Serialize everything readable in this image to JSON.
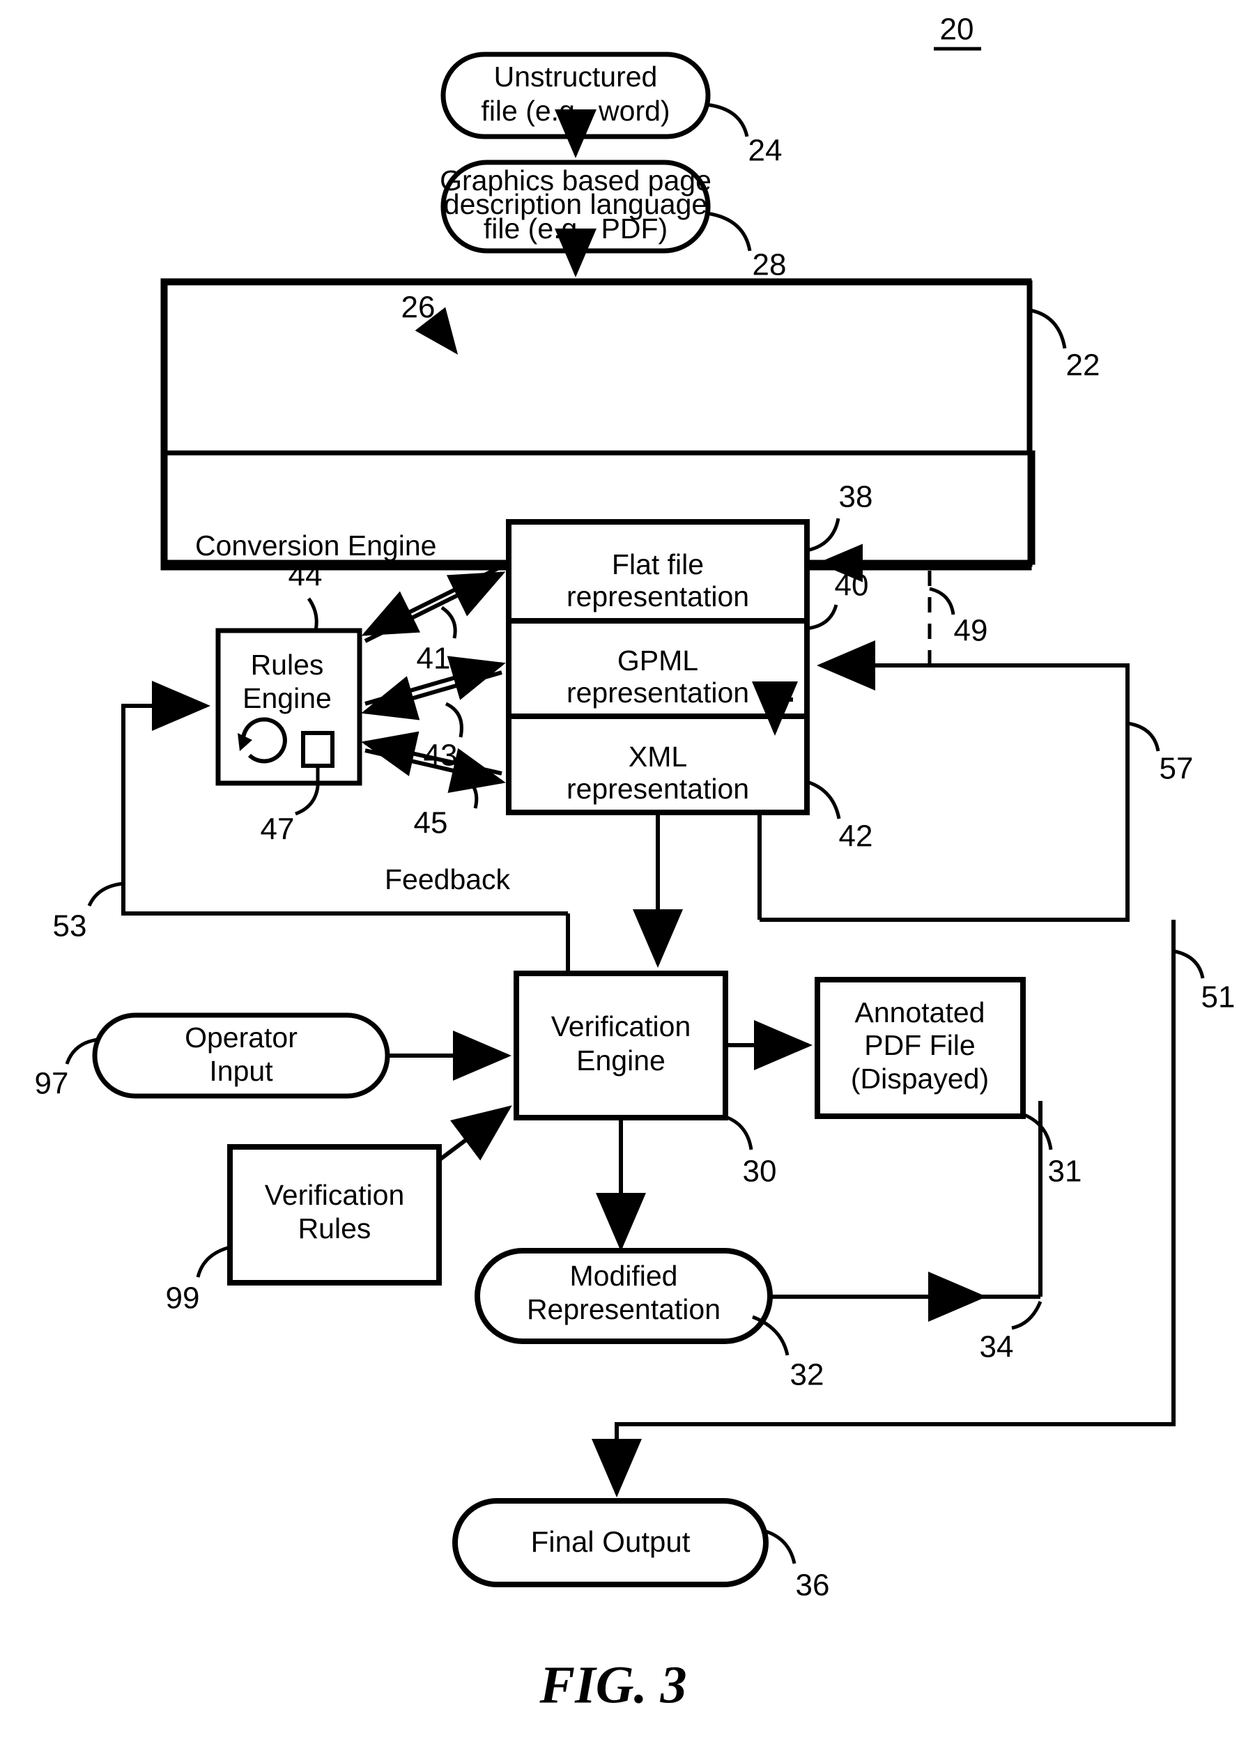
{
  "figure": {
    "caption": "FIG. 3",
    "system_ref": "20"
  },
  "nodes": {
    "unstructured_file": {
      "line1": "Unstructured",
      "line2": "file (e.g., word)",
      "ref": "24",
      "shape": "stadium"
    },
    "pdl_file": {
      "line1": "Graphics based page",
      "line2": "description language",
      "line3": "file (e.g., PDF)",
      "ref": "28",
      "shape": "stadium"
    },
    "system_box": {
      "ref": "22",
      "shape": "rect"
    },
    "conversion_engine": {
      "label": "Conversion Engine",
      "ref": "26",
      "shape": "rect"
    },
    "rules_engine": {
      "line1": "Rules",
      "line2": "Engine",
      "ref": "44",
      "inner_ref": "47",
      "shape": "rect"
    },
    "flat_file_representation": {
      "line1": "Flat file",
      "line2": "representation",
      "ref": "38",
      "shape": "rect"
    },
    "gpml_representation": {
      "line1": "GPML",
      "line2": "representation",
      "ref": "40",
      "shape": "rect"
    },
    "xml_representation": {
      "line1": "XML",
      "line2": "representation",
      "ref": "42",
      "shape": "rect"
    },
    "verification_engine": {
      "line1": "Verification",
      "line2": "Engine",
      "ref": "30",
      "shape": "rect"
    },
    "annotated_pdf": {
      "line1": "Annotated",
      "line2": "PDF File",
      "line3": "(Dispayed)",
      "ref": "31",
      "shape": "rect"
    },
    "operator_input": {
      "line1": "Operator",
      "line2": "Input",
      "ref": "97",
      "shape": "stadium"
    },
    "verification_rules": {
      "line1": "Verification",
      "line2": "Rules",
      "ref": "99",
      "shape": "rect"
    },
    "modified_representation": {
      "line1": "Modified",
      "line2": "Representation",
      "ref": "32",
      "shape": "stadium"
    },
    "final_output": {
      "label": "Final Output",
      "ref": "36",
      "shape": "stadium"
    }
  },
  "connectors": {
    "feedback_label": "Feedback",
    "rules_to_flatfile_ref": "41",
    "rules_to_gpml_ref": "43",
    "rules_to_xml_ref": "45",
    "dashed_return_ref": "49",
    "feedback_loop_ref": "53",
    "gpml_return_ref": "57",
    "output_return_ref": "51",
    "modified_out_ref": "34"
  },
  "style": {
    "ink": "#000000",
    "paper": "#ffffff"
  }
}
